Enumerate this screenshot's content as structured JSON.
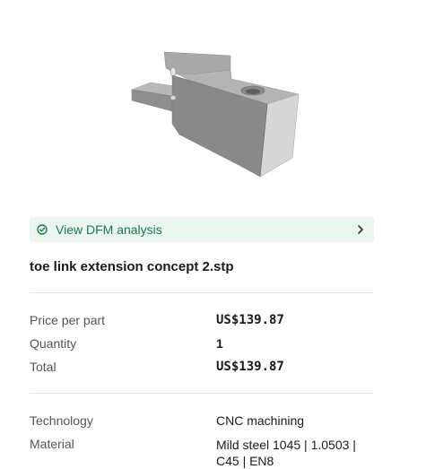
{
  "preview": {
    "alt": "3D part preview"
  },
  "dfm": {
    "label": "View DFM analysis",
    "icon": "check-circle-icon",
    "chevron_icon": "chevron-right-icon",
    "accent": "#1a7a4a",
    "background": "#eaf6ef"
  },
  "file": {
    "name": "toe link extension concept 2.stp"
  },
  "pricing": {
    "price_per_part_label": "Price per part",
    "price_per_part_value": "US$139.87",
    "quantity_label": "Quantity",
    "quantity_value": "1",
    "total_label": "Total",
    "total_value": "US$139.87"
  },
  "specs": {
    "technology_label": "Technology",
    "technology_value": "CNC machining",
    "material_label": "Material",
    "material_value": "Mild steel 1045 | 1.0503 | C45 | EN8"
  }
}
